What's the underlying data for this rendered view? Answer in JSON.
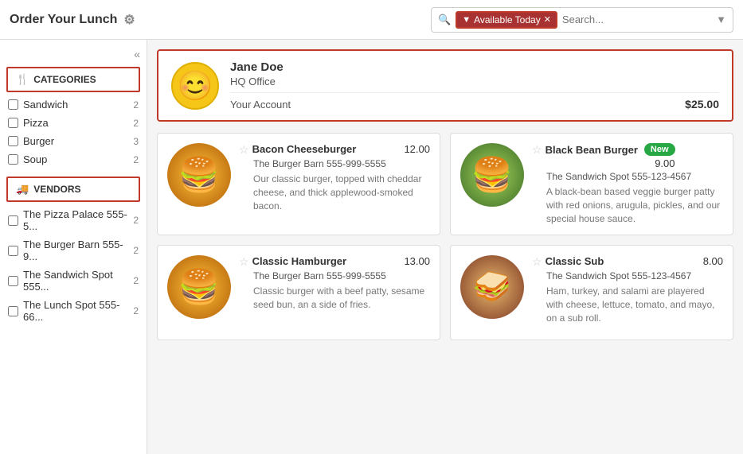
{
  "header": {
    "title": "Order Your Lunch",
    "gear_label": "⚙",
    "filter_tag": "Available Today",
    "search_placeholder": "Search...",
    "search_icon": "🔍"
  },
  "sidebar": {
    "collapse_icon": "«",
    "categories_label": "CATEGORIES",
    "categories_icon": "🍴",
    "vendors_label": "VENDORS",
    "vendors_icon": "🚚",
    "categories": [
      {
        "label": "Sandwich",
        "count": 2
      },
      {
        "label": "Pizza",
        "count": 2
      },
      {
        "label": "Burger",
        "count": 3
      },
      {
        "label": "Soup",
        "count": 2
      }
    ],
    "vendors": [
      {
        "label": "The Pizza Palace 555-5...",
        "count": 2
      },
      {
        "label": "The Burger Barn 555-9...",
        "count": 2
      },
      {
        "label": "The Sandwich Spot 555...",
        "count": 2
      },
      {
        "label": "The Lunch Spot 555-66...",
        "count": 2
      }
    ]
  },
  "account": {
    "name": "Jane Doe",
    "office": "HQ Office",
    "balance_label": "Your Account",
    "balance": "$25.00",
    "smiley": "😊"
  },
  "foods": [
    {
      "name": "Bacon Cheeseburger",
      "price": "12.00",
      "vendor": "The Burger Barn 555-999-5555",
      "desc": "Our classic burger, topped with cheddar cheese, and thick applewood-smoked bacon.",
      "is_new": false,
      "type": "burger"
    },
    {
      "name": "Black Bean Burger",
      "price": "9.00",
      "vendor": "The Sandwich Spot 555-123-4567",
      "desc": "A black-bean based veggie burger patty with red onions, arugula, pickles, and our special house sauce.",
      "is_new": true,
      "type": "burger-green"
    },
    {
      "name": "Classic Hamburger",
      "price": "13.00",
      "vendor": "The Burger Barn 555-999-5555",
      "desc": "Classic burger with a beef patty, sesame seed bun, an a side of fries.",
      "is_new": false,
      "type": "burger"
    },
    {
      "name": "Classic Sub",
      "price": "8.00",
      "vendor": "The Sandwich Spot 555-123-4567",
      "desc": "Ham, turkey, and salami are playered with cheese, lettuce, tomato, and mayo, on a sub roll.",
      "is_new": false,
      "type": "sub"
    }
  ]
}
